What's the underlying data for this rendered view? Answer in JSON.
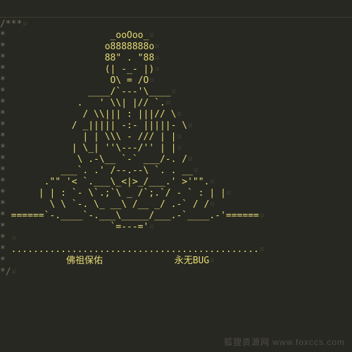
{
  "editor": {
    "comment_open": "/***",
    "comment_close": "*/",
    "prefix": "* ",
    "whitespace_marker": "¤",
    "buddha_lines": [
      "                  _ooOoo_",
      "                 o8888888o",
      "                 88\" . \"88",
      "                 (| -_- |)",
      "                  O\\ = /O",
      "              ____/`---'\\____",
      "            .   ' \\\\| |// `.",
      "             / \\\\||| : |||// \\",
      "           / _||||| -:- |||||- \\",
      "             | | \\\\\\ - /// | |",
      "           | \\_| ''\\---/'' | |",
      "            \\ .-\\__ `-` ___/-. /",
      "         ___`. .' /--.--\\ `. . __",
      "      .\"\" '< `.___\\_<|>_/___.' >'\"\".",
      "     | | : `- \\`.;`\\ _ /`;.`/ - ` : | |",
      "       \\ \\ `-. \\_ __\\ /__ _/ .-` / /",
      "======`-.____`-.___\\_____/___.-`____.-'======",
      "                  `=---='"
    ],
    "separator": "",
    "dots": ".............................................",
    "blessing_left": "佛祖保佑",
    "blessing_right": "永无BUG"
  },
  "watermark": "狐狸资源网   www.foxccs.com"
}
